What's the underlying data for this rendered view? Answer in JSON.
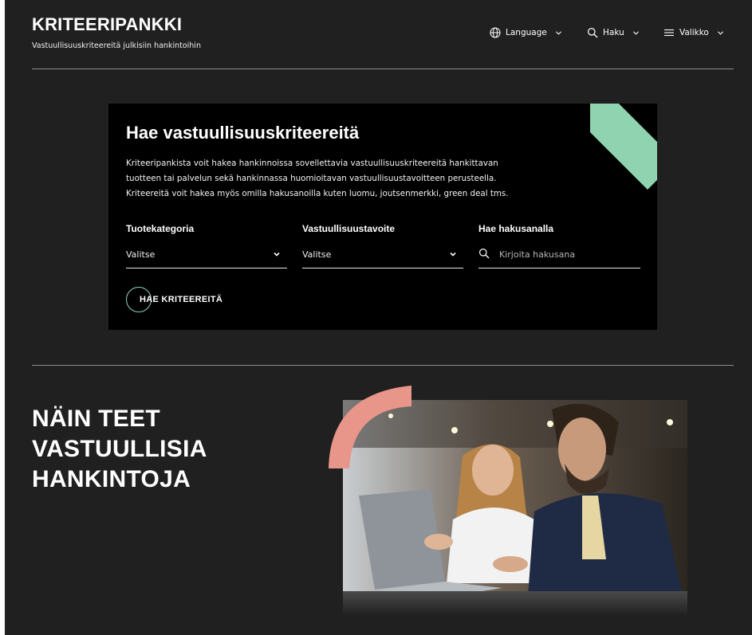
{
  "header": {
    "title": "KRITEERIPANKKI",
    "subtitle": "Vastuullisuuskriteereitä julkisiin hankintoihin",
    "nav": {
      "language_label": "Language",
      "search_label": "Haku",
      "menu_label": "Valikko"
    }
  },
  "search_panel": {
    "title": "Hae vastuullisuuskriteereitä",
    "intro_lines": [
      "Kriteeripankista voit hakea hankinnoissa sovellettavia vastuullisuuskriteereitä hankittavan",
      "tuotteen tai palvelun sekä hankinnassa huomioitavan vastuullisuustavoitteen perusteella.",
      "Kriteereitä voit hakea myös omilla hakusanoilla kuten luomu, joutsenmerkki, green deal tms."
    ],
    "category": {
      "label": "Tuotekategoria",
      "value": "Valitse"
    },
    "goal": {
      "label": "Vastuullisuustavoite",
      "value": "Valitse"
    },
    "keyword": {
      "label": "Hae hakusanalla",
      "placeholder": "Kirjoita hakusana"
    },
    "submit_label": "HAE KRITEEREITÄ"
  },
  "hero": {
    "title_lines": [
      "NÄIN TEET",
      "VASTUULLISIA",
      "HANKINTOJA"
    ]
  },
  "colors": {
    "background": "#202020",
    "panel": "#000000",
    "mint_accent": "#8fd3b0",
    "salmon_accent": "#e8958a"
  }
}
